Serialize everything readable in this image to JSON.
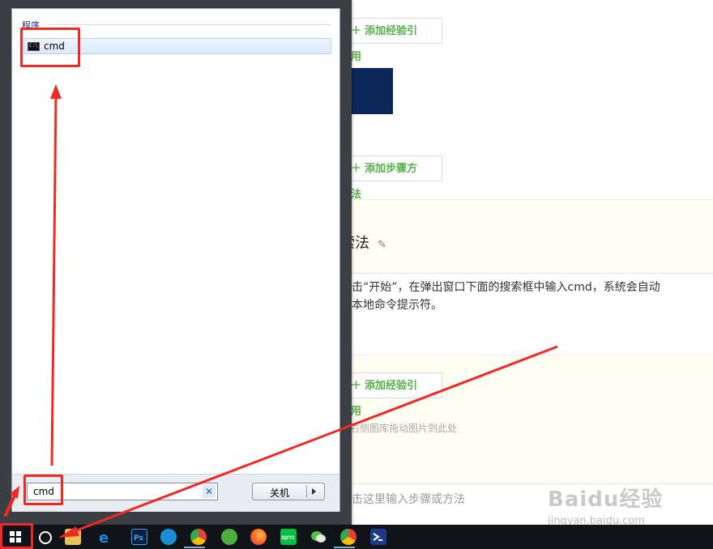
{
  "background_page": {
    "add_reference_label_1": "添加经验引用",
    "add_step_label": "添加步骤方法",
    "section_heading": "索法",
    "paragraph_line_1": "点击“开始”，在弹出窗口下面的搜索框中输入cmd，系统会自动",
    "paragraph_line_2": "到本地命令提示符。",
    "add_reference_label_2": "添加经验引用",
    "drag_hint": "或右侧图库拖动图片到此处",
    "step_input_hint": "点击这里输入步骤或方法",
    "watermark_logo": "Baidu经验",
    "watermark_url": "jingyan.baidu.com"
  },
  "start_menu": {
    "group_title": "程序",
    "result_label": "cmd",
    "search_value": "cmd",
    "search_clear": "✕",
    "shutdown_label": "关机"
  },
  "taskbar": {
    "icons": [
      "windows-start-icon",
      "cortana-icon",
      "file-explorer-icon",
      "ie-icon",
      "photoshop-icon",
      "app-m-icon",
      "chrome-icon",
      "browser-icon",
      "firefox-icon",
      "iqiyi-icon",
      "wechat-icon",
      "chrome-2-icon",
      "powershell-icon"
    ],
    "photoshop_glyph": "Ps",
    "iqiyi_glyph": "iQIYI"
  },
  "colors": {
    "annotation_red": "#ee2a24",
    "accent_green": "#56b04a",
    "taskbar": "#101418"
  }
}
